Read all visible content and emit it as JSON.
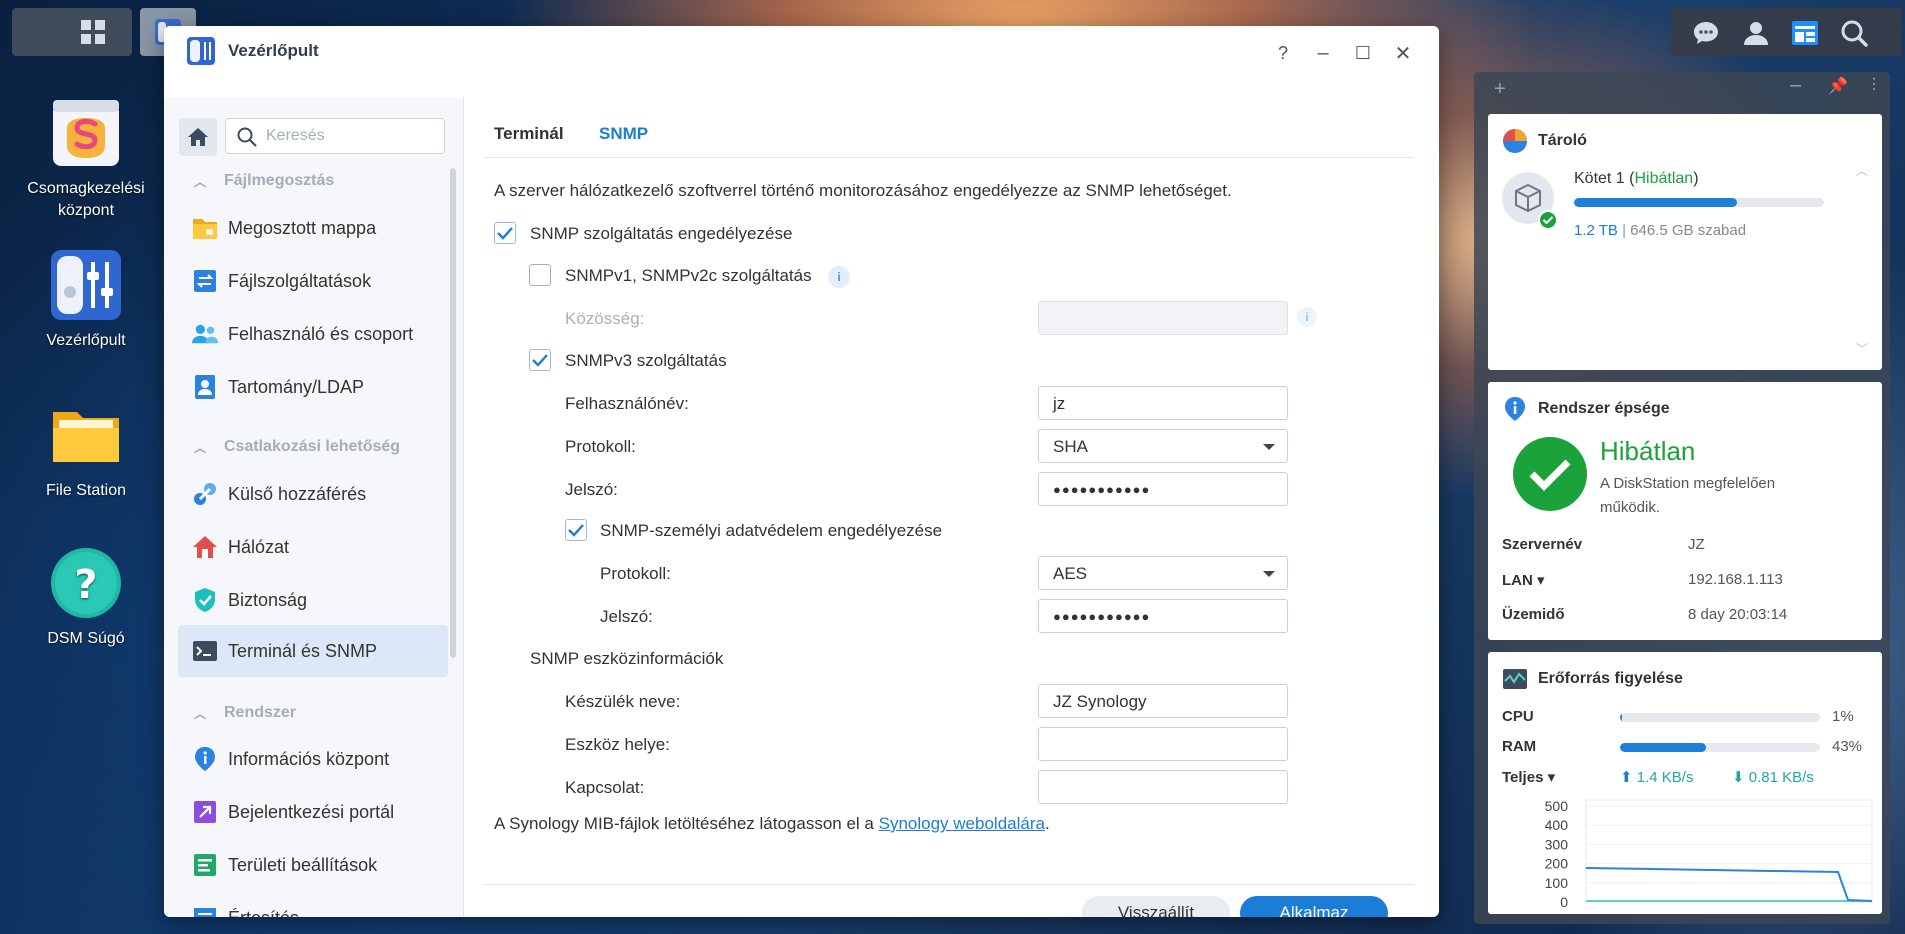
{
  "window": {
    "title": "Vezérlőpult",
    "help": "?",
    "minimize": "–",
    "maximize": "☐",
    "close": "✕"
  },
  "desktop": {
    "icons": [
      {
        "label": "Csomagkezelési központ"
      },
      {
        "label": "Vezérlőpult"
      },
      {
        "label": "File Station"
      },
      {
        "label": "DSM Súgó"
      }
    ]
  },
  "sidebar": {
    "search_placeholder": "Keresés",
    "groups": {
      "files": "Fájlmegosztás",
      "connectivity": "Csatlakozási lehetőség",
      "system": "Rendszer"
    },
    "items": [
      {
        "label": "Megosztott mappa",
        "icon": "folder-icon"
      },
      {
        "label": "Fájlszolgáltatások",
        "icon": "file-services-icon"
      },
      {
        "label": "Felhasználó és csoport",
        "icon": "users-icon"
      },
      {
        "label": "Tartomány/LDAP",
        "icon": "domain-icon"
      },
      {
        "label": "Külső hozzáférés",
        "icon": "external-access-icon"
      },
      {
        "label": "Hálózat",
        "icon": "network-icon"
      },
      {
        "label": "Biztonság",
        "icon": "shield-icon"
      },
      {
        "label": "Terminál és SNMP",
        "icon": "terminal-icon"
      },
      {
        "label": "Információs központ",
        "icon": "info-icon"
      },
      {
        "label": "Bejelentkezési portál",
        "icon": "portal-icon"
      },
      {
        "label": "Területi beállítások",
        "icon": "regional-icon"
      },
      {
        "label": "Értesítés",
        "icon": "notification-icon"
      }
    ]
  },
  "tabs": {
    "terminal": "Terminál",
    "snmp": "SNMP"
  },
  "snmp": {
    "description": "A szerver hálózatkezelő szoftverrel történő monitorozásához engedélyezze az SNMP lehetőséget.",
    "enable_label": "SNMP szolgáltatás engedélyezése",
    "v1v2_label": "SNMPv1, SNMPv2c szolgáltatás",
    "community_label": "Közösség:",
    "community_value": "",
    "v3_label": "SNMPv3 szolgáltatás",
    "username_label": "Felhasználónév:",
    "username_value": "jz",
    "protocol_label": "Protokoll:",
    "protocol_value": "SHA",
    "password_label": "Jelszó:",
    "password_value": "●●●●●●●●●●●",
    "privacy_label": "SNMP-személyi adatvédelem engedélyezése",
    "privacy_protocol_label": "Protokoll:",
    "privacy_protocol_value": "AES",
    "privacy_password_label": "Jelszó:",
    "privacy_password_value": "●●●●●●●●●●●",
    "device_info_heading": "SNMP eszközinformációk",
    "device_name_label": "Készülék neve:",
    "device_name_value": "JZ Synology",
    "device_location_label": "Eszköz helye:",
    "device_location_value": "",
    "contact_label": "Kapcsolat:",
    "contact_value": "",
    "mib_text": "A Synology MIB-fájlok letöltéséhez látogasson el a",
    "mib_link": "Synology weboldalára",
    "mib_period": "."
  },
  "footer": {
    "reset": "Visszaállít",
    "apply": "Alkalmaz"
  },
  "widgets": {
    "storage": {
      "title": "Tároló",
      "volume_name": "Kötet 1 (",
      "volume_status": "Hibátlan",
      "volume_close": ")",
      "total": "1.2 TB",
      "separator": " | ",
      "free": "646.5 GB szabad",
      "usage_fraction": 0.65
    },
    "health": {
      "title": "Rendszer épsége",
      "status": "Hibátlan",
      "message": "A DiskStation megfelelően működik.",
      "server_label": "Szervernév",
      "server_value": "JZ",
      "lan_label": "LAN ▾",
      "lan_value": "192.168.1.113",
      "uptime_label": "Üzemidő",
      "uptime_value": "8 day 20:03:14"
    },
    "resource": {
      "title": "Erőforrás figyelése",
      "cpu_label": "CPU",
      "cpu_value": "1%",
      "cpu_fraction": 0.01,
      "ram_label": "RAM",
      "ram_value": "43%",
      "ram_fraction": 0.43,
      "net_label": "Teljes ▾",
      "upload": "1.4 KB/s",
      "download": "0.81 KB/s",
      "chart_ticks": [
        "500",
        "400",
        "300",
        "200",
        "100",
        "0"
      ]
    }
  },
  "colors": {
    "accent": "#1b7dd7",
    "ok_green": "#1ca23b",
    "apply_bg": "#1b7dd7"
  }
}
